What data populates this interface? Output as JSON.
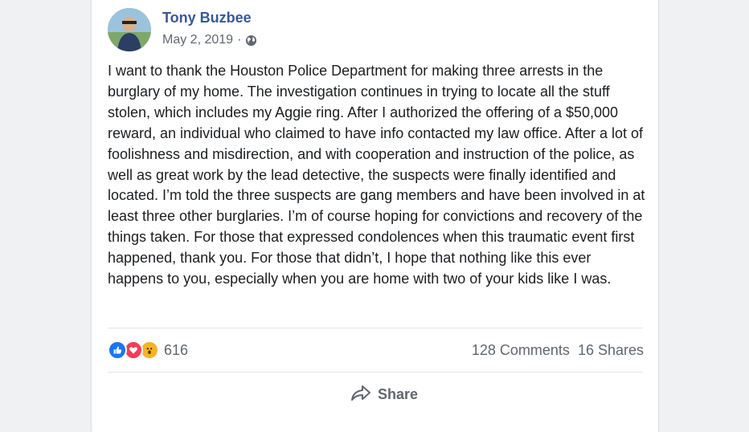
{
  "post": {
    "author": "Tony Buzbee",
    "date": "May 2, 2019",
    "separator": "·",
    "privacy_icon": "globe-icon",
    "text": "I want to thank the Houston Police Department for making three arrests in the burglary of my home. The investigation continues in trying to locate all the stuff stolen, which includes my Aggie ring. After I authorized the offering of a $50,000 reward, an individual who claimed to have info contacted my law office. After a lot of foolishness and misdirection, and with cooperation and instruction of the police, as well as great work by the lead detective, the suspects were finally identified and located. I’m told the three suspects are gang members and have been involved in at least three other burglaries. I’m of course hoping for convictions and recovery of the things taken. For those that expressed condolences when this traumatic event first happened, thank you. For those that didn’t, I hope that nothing like this ever happens to you, especially when you are home with two of your kids like I was."
  },
  "engagement": {
    "reaction_icons": [
      "like-icon",
      "love-icon",
      "wow-icon"
    ],
    "reaction_count": "616",
    "comments": "128 Comments",
    "shares": "16 Shares"
  },
  "actions": {
    "share_label": "Share"
  },
  "colors": {
    "author_link": "#385898",
    "like": "#1877f2",
    "love": "#f33e58",
    "wow": "#f7b125"
  }
}
